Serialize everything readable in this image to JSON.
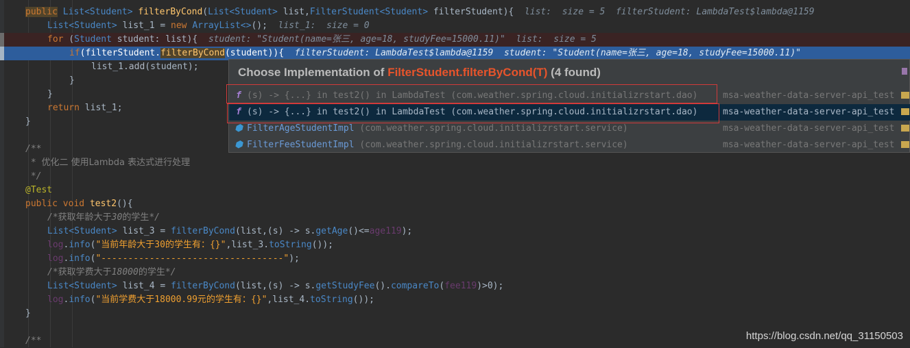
{
  "editor": {
    "line1": {
      "kw_public": "public",
      "ret_type": "List<Student>",
      "method": "filterByCond",
      "param1_type": "List<Student>",
      "param1_name": "list,",
      "param2_type": "FilterStudent<Student>",
      "param2_name": "filterStudent){",
      "hint": "list:  size = 5  filterStudent: LambdaTest$lambda@1159"
    },
    "line2": {
      "type": "List<Student>",
      "rest": "list_1 = ",
      "kw_new": "new",
      "ctor": "ArrayList<>",
      "tail": "();",
      "hint": "list_1:  size = 0"
    },
    "line3": {
      "kw_for": "for",
      "open": " (",
      "type": "Student",
      "rest": " student: list){",
      "hint_a": "student: \"Student(name=",
      "hint_cn": "张三",
      "hint_b": ", age=18, studyFee=15000.11)\"  list:  size = 5"
    },
    "line4": {
      "kw_if": "if",
      "open": "(filterStudent.",
      "call": "filterByCond",
      "rest": "(student)){",
      "hint_a": "filterStudent: LambdaTest$lambda@1159  student: \"Student(name=",
      "hint_cn": "张三",
      "hint_b": ", age=18, studyFee=15000.11)\""
    },
    "line5": {
      "obj": "list_1.",
      "call": "add",
      "rest": "(student);"
    },
    "line6": "}",
    "line7": "}",
    "line8": {
      "kw_return": "return",
      "rest": " list_1;"
    },
    "line9": "}",
    "line11": "/**",
    "line12": {
      "a": " * ",
      "cn": "优化二 使用Lambda 表达式进行处理"
    },
    "line13": " */",
    "line14": "@Test",
    "line15": {
      "kw_public": "public",
      "kw_void": "void",
      "method": "test2",
      "rest": "(){"
    },
    "line16": {
      "a": "/*",
      "cn1": "获取年龄大于",
      "num": "30",
      "cn2": "的学生",
      "b": "*/"
    },
    "line17": {
      "type": "List<Student>",
      "rest": " list_3 = ",
      "call": "filterByCond",
      "args": "(list,(s) -> s.",
      "getter": "getAge",
      "cmp": "()<=",
      "dim": "age119",
      "end": ");"
    },
    "line18": {
      "log": "log",
      "dot": ".",
      "call": "info",
      "open": "(",
      "str_a": "\"",
      "str_cn1": "当前年龄大于",
      "str_num": "30",
      "str_cn2": "的学生有：",
      "str_b": "{}\"",
      "rest": ",list_3.",
      "call2": "toString",
      "end": "());"
    },
    "line19": {
      "log": "log",
      "dot": ".",
      "call": "info",
      "open": "(",
      "str": "\"----------------------------------\"",
      "end": ");"
    },
    "line20": {
      "a": "/*",
      "cn1": "获取学费大于",
      "num": "18000",
      "cn2": "的学生",
      "b": "*/"
    },
    "line21": {
      "type": "List<Student>",
      "rest": " list_4 = ",
      "call": "filterByCond",
      "args": "(list,(s) -> s.",
      "getter": "getStudyFee",
      "mid": "().",
      "call2": "compareTo",
      "open": "(",
      "dim": "fee119",
      "end": ")>0);"
    },
    "line22": {
      "log": "log",
      "dot": ".",
      "call": "info",
      "open": "(",
      "str_a": "\"",
      "str_cn1": "当前学费大于",
      "str_num": "18000.99",
      "str_cn2": "元的学生有：",
      "str_b": "{}\"",
      "rest": ",list_4.",
      "call2": "toString",
      "end": "());"
    },
    "line23": "}",
    "line25": "/**"
  },
  "popup": {
    "title_prefix": "Choose Implementation of ",
    "title_method": "FilterStudent.filterByCond(T)",
    "title_count": " (4 found)",
    "items": [
      {
        "icon": "f",
        "sig": "(s) -> {...} in test2() in LambdaTest",
        "pkg": " (com.weather.spring.cloud.initializrstart.dao)",
        "module": "msa-weather-data-server-api_test"
      },
      {
        "icon": "f",
        "sig": "(s) -> {...} in test2() in LambdaTest",
        "pkg": " (com.weather.spring.cloud.initializrstart.dao)",
        "module": "msa-weather-data-server-api_test"
      },
      {
        "icon": "class-icon",
        "sig": "FilterAgeStudentImpl",
        "pkg": " (com.weather.spring.cloud.initializrstart.service)",
        "module": "msa-weather-data-server-api_test"
      },
      {
        "icon": "class-icon",
        "sig": "FilterFeeStudentImpl",
        "pkg": " (com.weather.spring.cloud.initializrstart.service)",
        "module": "msa-weather-data-server-api_test"
      }
    ]
  },
  "watermark": "https://blog.csdn.net/qq_31150503",
  "colors": {
    "keyword": "#cc7832",
    "method": "#ffc66d",
    "string": "#6a8759",
    "exec_line": "#2d5d9c",
    "popup_accent": "#e8542b"
  }
}
